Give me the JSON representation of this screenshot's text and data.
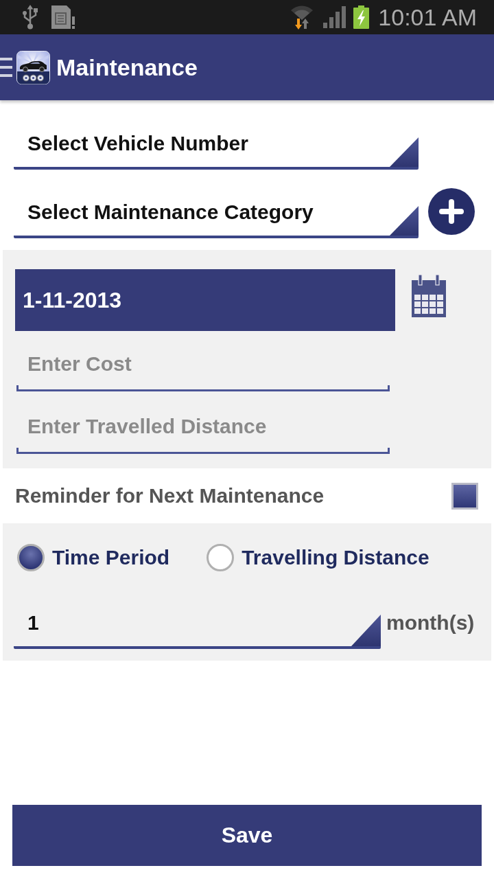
{
  "status_bar": {
    "time": "10:01 AM"
  },
  "app_bar": {
    "title": "Maintenance"
  },
  "form": {
    "dropdowns": [
      {
        "value": "Select Vehicle Number",
        "add_button": false
      },
      {
        "value": "Select Maintenance Category",
        "add_button": true
      }
    ],
    "date_field": {
      "value": "1-11-2013"
    },
    "cost_field": {
      "placeholder": "Enter Cost"
    },
    "distance_field": {
      "placeholder": "Enter Travelled Distance"
    },
    "reminder": {
      "label": "Reminder for Next Maintenance",
      "checked": true
    },
    "reminder_type": [
      {
        "label": "Time Period",
        "selected": true
      },
      {
        "label": "Travelling Distance",
        "selected": false
      }
    ],
    "interval": {
      "value": "1",
      "unit": "month(s)"
    }
  },
  "buttons": [
    {
      "label": "Save"
    }
  ]
}
